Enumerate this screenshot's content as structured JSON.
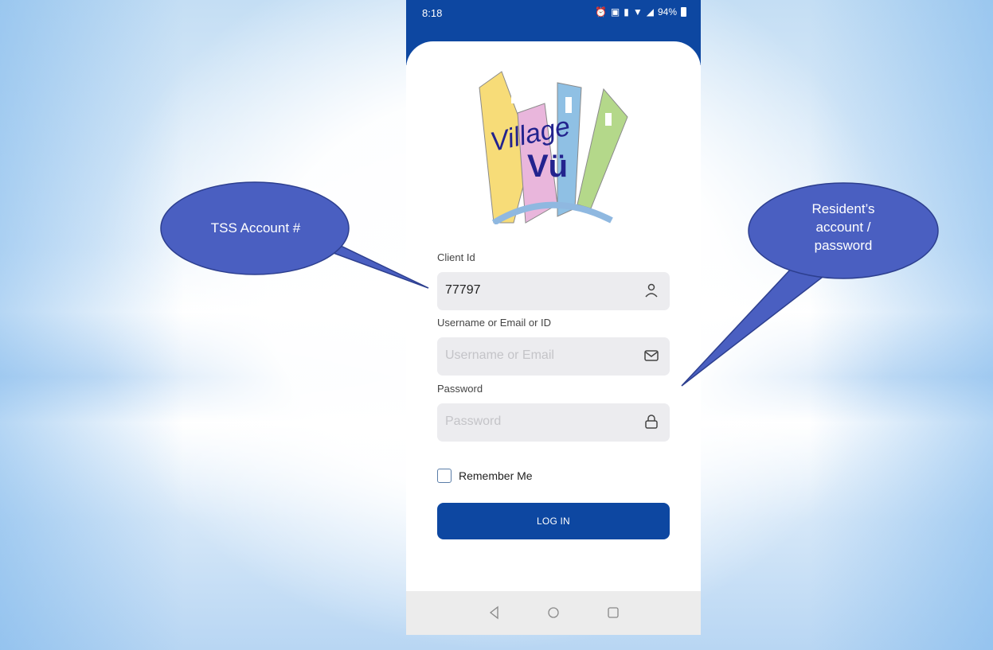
{
  "status_bar": {
    "time": "8:18",
    "battery": "94%",
    "icons": [
      "alarm-icon",
      "app-icon",
      "vibrate-icon",
      "wifi-icon",
      "signal-icon",
      "battery-icon"
    ]
  },
  "logo": {
    "line1": "Village",
    "line2": "Vü"
  },
  "form": {
    "client_id_label": "Client Id",
    "client_id_value": "77797",
    "username_label": "Username or Email or ID",
    "username_placeholder": "Username or Email",
    "password_label": "Password",
    "password_placeholder": "Password",
    "remember_label": "Remember Me",
    "remember_checked": false,
    "login_label": "LOG IN"
  },
  "nav": [
    "back-icon",
    "home-icon",
    "recents-icon"
  ],
  "callouts": {
    "left": "TSS Account #",
    "right_line1": "Resident’s",
    "right_line2": "account /",
    "right_line3": "password"
  },
  "colors": {
    "primary": "#0d47a1",
    "callout": "#4a5fc1",
    "field_bg": "#ececef"
  }
}
